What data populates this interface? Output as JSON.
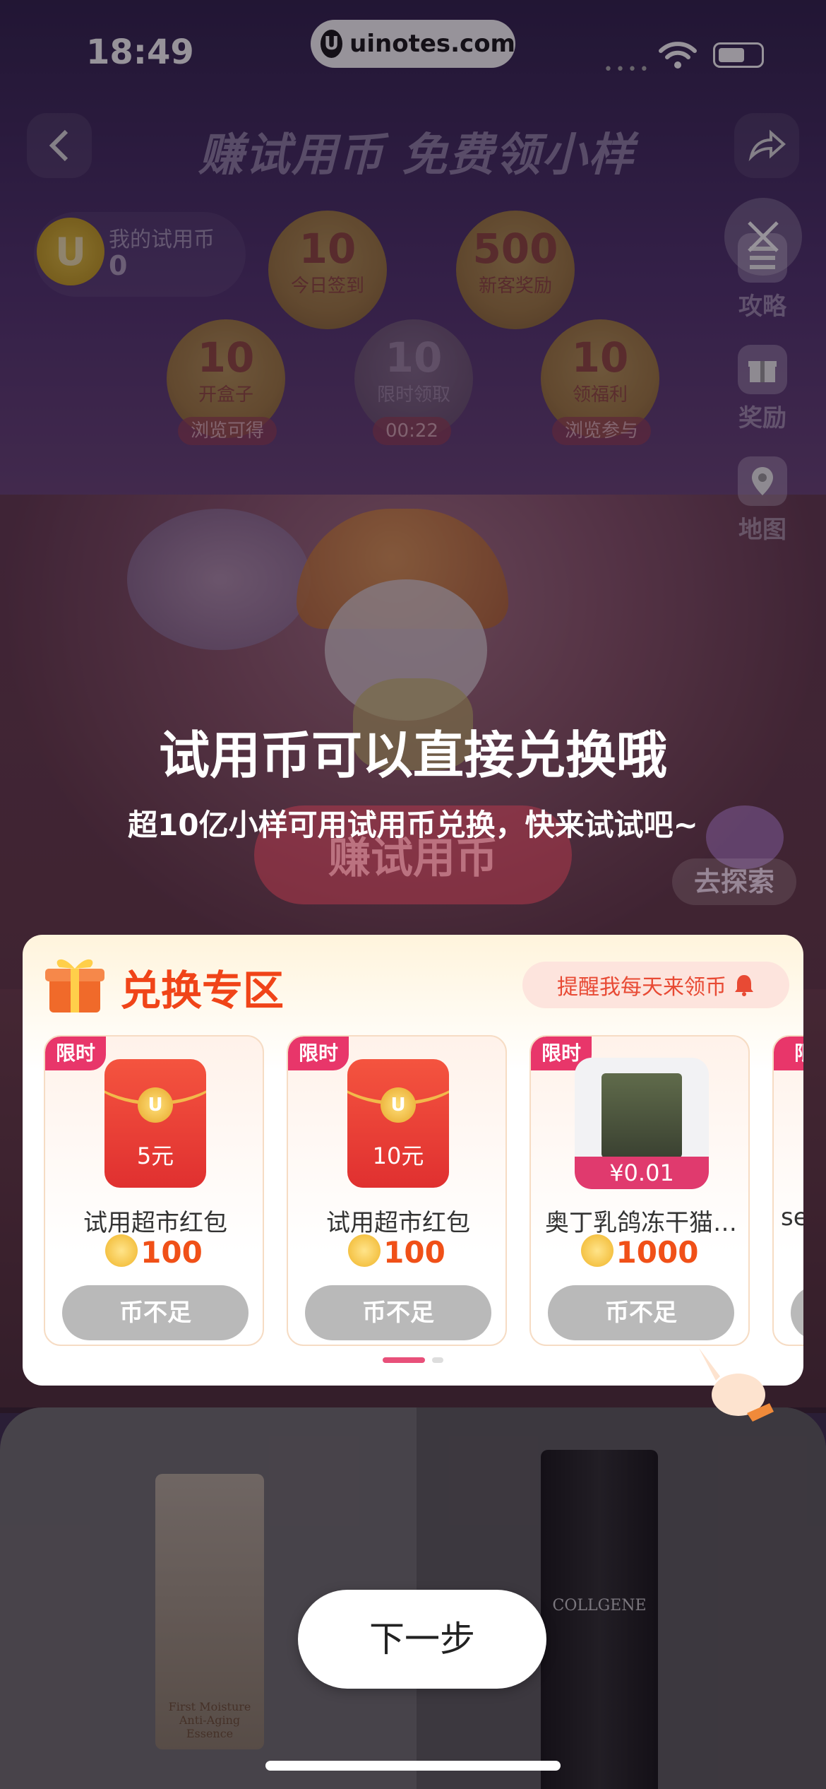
{
  "status_bar": {
    "time": "18:49",
    "url": "uinotes.com"
  },
  "header": {
    "title": "赚试用币 免费领小样"
  },
  "my_coins": {
    "label": "我的试用币",
    "value": "0"
  },
  "coin_tasks": [
    {
      "num": "10",
      "caption": "今日签到",
      "tag": ""
    },
    {
      "num": "500",
      "caption": "新客奖励",
      "tag": ""
    },
    {
      "num": "10",
      "caption": "开盒子",
      "tag": "浏览可得"
    },
    {
      "num": "10",
      "caption": "限时领取",
      "tag": "00:22"
    },
    {
      "num": "10",
      "caption": "领福利",
      "tag": "浏览参与"
    }
  ],
  "side_menu": [
    {
      "label": "攻略",
      "icon": "list-icon"
    },
    {
      "label": "奖励",
      "icon": "gift-icon"
    },
    {
      "label": "地图",
      "icon": "map-pin-icon"
    }
  ],
  "overlay": {
    "title": "试用币可以直接兑换哦",
    "subtitle": "超10亿小样可用试用币兑换，快来试试吧~"
  },
  "earn_button": "赚试用币",
  "explore_button": "去探索",
  "exchange": {
    "title": "兑换专区",
    "remind_label": "提醒我每天来领币",
    "products": [
      {
        "badge": "限时",
        "amount": "5元",
        "name": "试用超市红包",
        "price": "100",
        "button": "币不足"
      },
      {
        "badge": "限时",
        "amount": "10元",
        "name": "试用超市红包",
        "price": "100",
        "button": "币不足"
      },
      {
        "badge": "限时",
        "sale_price": "¥0.01",
        "name": "奥丁乳鸽冻干猫…",
        "price": "1000",
        "button": "币不足"
      },
      {
        "badge": "限",
        "name": "se",
        "price": "",
        "button": ""
      }
    ]
  },
  "bottom": {
    "left_brand": "First Moisture Anti-Aging Essence",
    "right_brand": "COLLGENE",
    "next_button": "下一步"
  },
  "colors": {
    "accent": "#f04418",
    "badge": "#e8366a",
    "disabled": "#b9b9b9"
  }
}
